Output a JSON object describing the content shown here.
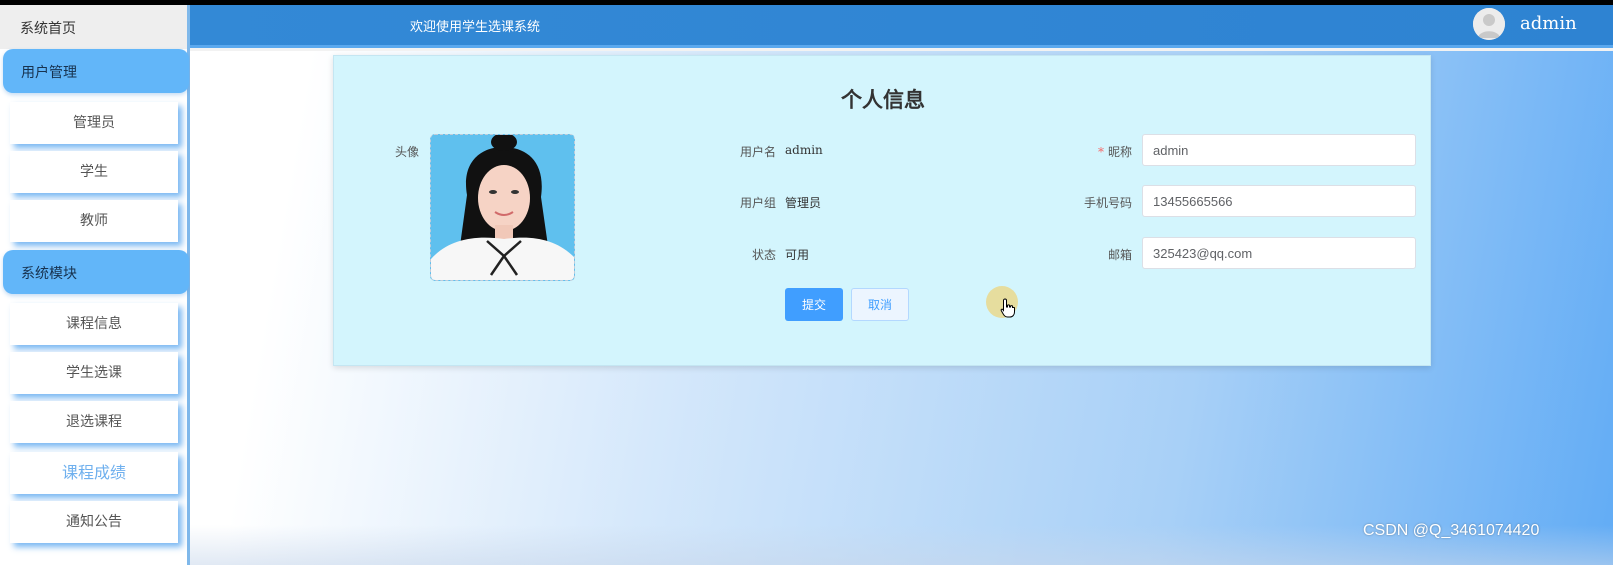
{
  "sidebar": {
    "home": "系统首页",
    "groups": [
      {
        "label": "用户管理",
        "items": [
          "管理员",
          "学生",
          "教师"
        ]
      },
      {
        "label": "系统模块",
        "items": [
          "课程信息",
          "学生选课",
          "退选课程",
          "课程成绩",
          "通知公告"
        ]
      }
    ],
    "active_item": "课程成绩"
  },
  "header": {
    "title": "欢迎使用学生选课系统",
    "username": "admin",
    "avatar_icon": "user-avatar-icon"
  },
  "form": {
    "title": "个人信息",
    "avatar_label": "头像",
    "username_label": "用户名",
    "username_value": "admin",
    "group_label": "用户组",
    "group_value": "管理员",
    "status_label": "状态",
    "status_value": "可用",
    "nickname_label": "昵称",
    "nickname_required_mark": "*",
    "nickname_value": "admin",
    "phone_label": "手机号码",
    "phone_value": "13455665566",
    "email_label": "邮箱",
    "email_value": "325423@qq.com",
    "submit_label": "提交",
    "cancel_label": "取消"
  },
  "watermark": "CSDN @Q_3461074420",
  "colors": {
    "primary": "#409eff",
    "header_bg": "#2e83d2",
    "card_bg": "#d3f5fd",
    "sidebar_group_bg": "#62b6f9",
    "required": "#f56c6c"
  }
}
